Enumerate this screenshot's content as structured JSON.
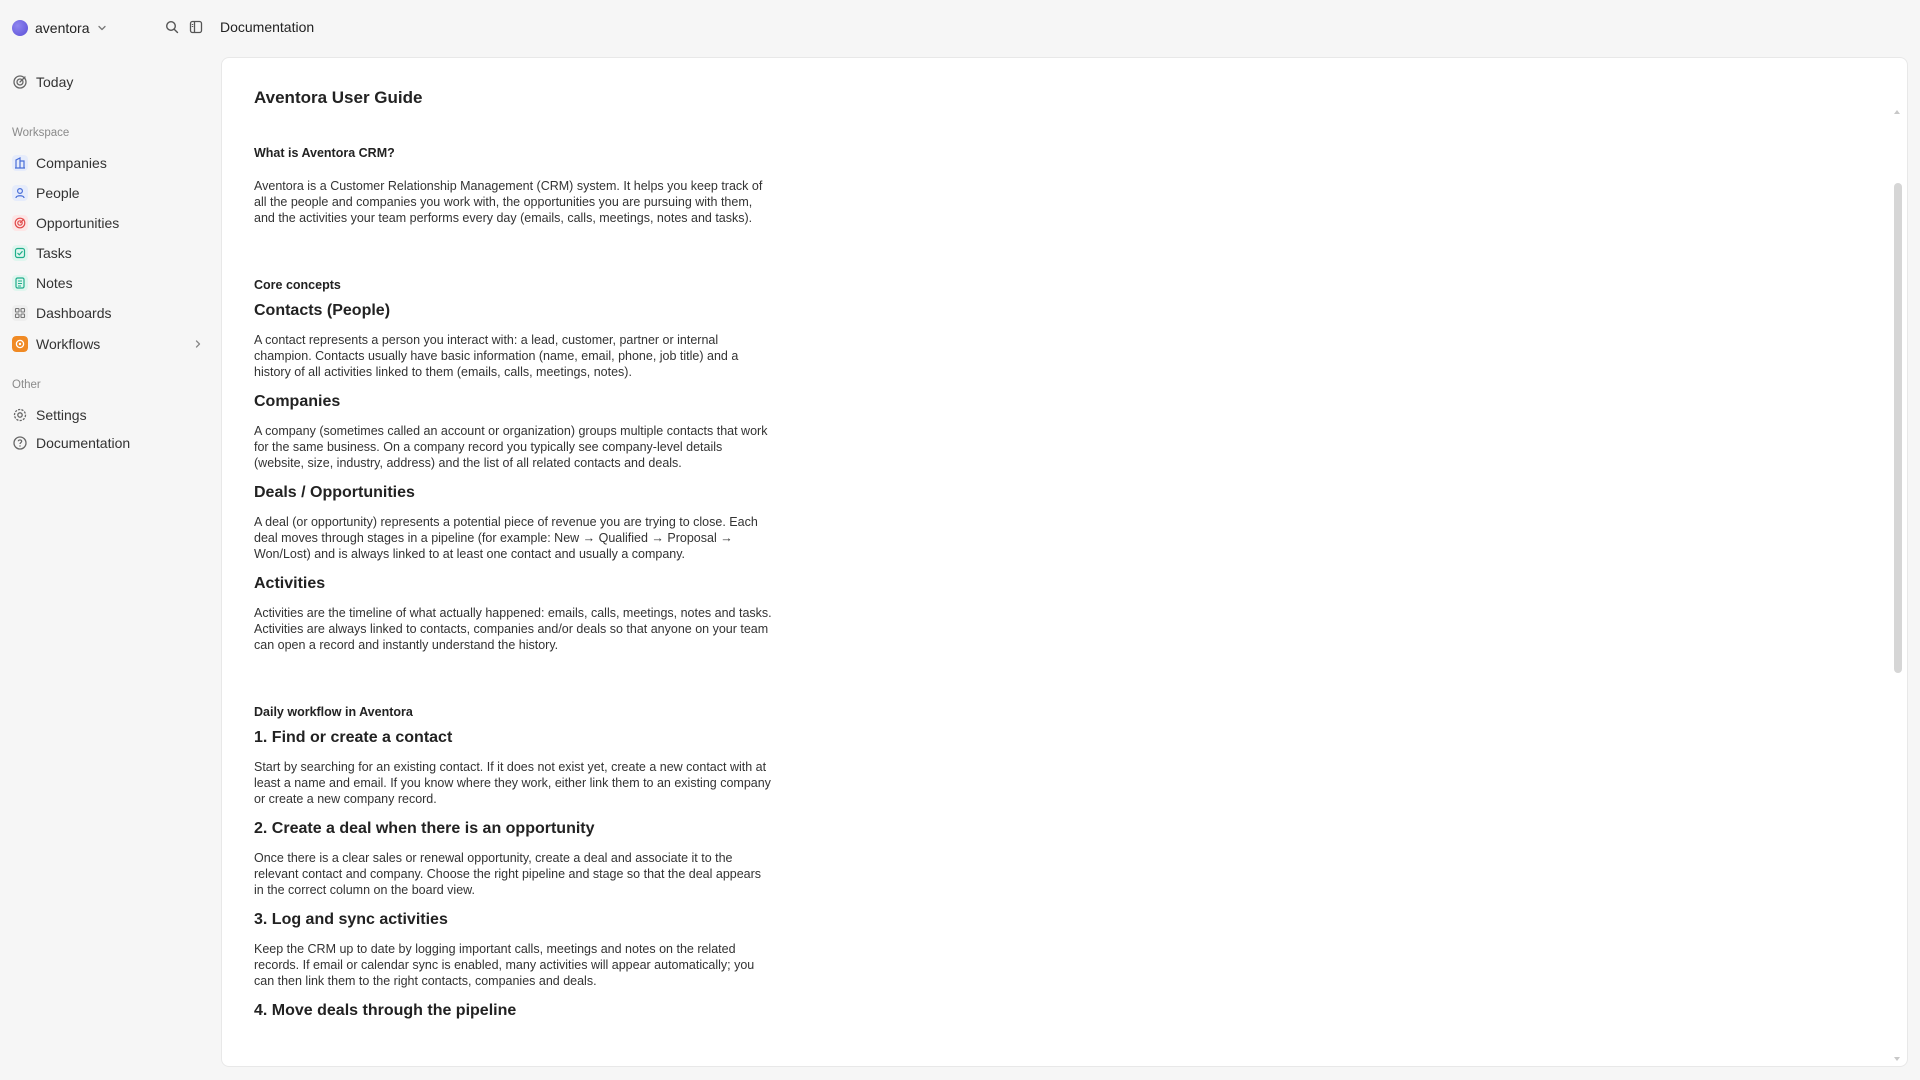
{
  "topbar": {
    "workspace_name": "aventora",
    "breadcrumb": "Documentation"
  },
  "sidebar": {
    "today": "Today",
    "workspace_label": "Workspace",
    "items": [
      {
        "label": "Companies",
        "icon": "building-icon",
        "color": "#4a6fd8"
      },
      {
        "label": "People",
        "icon": "person-icon",
        "color": "#4a6fd8"
      },
      {
        "label": "Opportunities",
        "icon": "target-icon",
        "color": "#e04a4a"
      },
      {
        "label": "Tasks",
        "icon": "checkbox-icon",
        "color": "#1fae8a"
      },
      {
        "label": "Notes",
        "icon": "note-icon",
        "color": "#1fae8a"
      },
      {
        "label": "Dashboards",
        "icon": "grid-icon",
        "color": "#888888"
      },
      {
        "label": "Workflows",
        "icon": "workflow-icon",
        "color": "#f08a24"
      }
    ],
    "other_label": "Other",
    "settings": "Settings",
    "documentation": "Documentation"
  },
  "doc": {
    "title": "Aventora User Guide",
    "what_heading": "What is Aventora CRM?",
    "what_text": "Aventora is a Customer Relationship Management (CRM) system. It helps you keep track of all the people and companies you work with, the opportunities you are pursuing with them, and the activities your team performs every day (emails, calls, meetings, notes and tasks).",
    "core_heading": "Core concepts",
    "contacts_heading": "Contacts (People)",
    "contacts_text": "A contact represents a person you interact with: a lead, customer, partner or internal champion. Contacts usually have basic information (name, email, phone, job title) and a history of all activities linked to them (emails, calls, meetings, notes).",
    "companies_heading": "Companies",
    "companies_text": "A company (sometimes called an account or organization) groups multiple contacts that work for the same business. On a company record you typically see company-level details (website, size, industry, address) and the list of all related contacts and deals.",
    "deals_heading": "Deals / Opportunities",
    "deals_text": "A deal (or opportunity) represents a potential piece of revenue you are trying to close. Each deal moves through stages in a pipeline (for example: New → Qualified → Proposal → Won/Lost) and is always linked to at least one contact and usually a company.",
    "activities_heading": "Activities",
    "activities_text": "Activities are the timeline of what actually happened: emails, calls, meetings, notes and tasks. Activities are always linked to contacts, companies and/or deals so that anyone on your team can open a record and instantly understand the history.",
    "daily_heading": "Daily workflow in Aventora",
    "step1_heading": "1. Find or create a contact",
    "step1_text": "Start by searching for an existing contact. If it does not exist yet, create a new contact with at least a name and email. If you know where they work, either link them to an existing company or create a new company record.",
    "step2_heading": "2. Create a deal when there is an opportunity",
    "step2_text": "Once there is a clear sales or renewal opportunity, create a deal and associate it to the relevant contact and company. Choose the right pipeline and stage so that the deal appears in the correct column on the board view.",
    "step3_heading": "3. Log and sync activities",
    "step3_text": "Keep the CRM up to date by logging important calls, meetings and notes on the related records. If email or calendar sync is enabled, many activities will appear automatically; you can then link them to the right contacts, companies and deals.",
    "step4_heading": "4. Move deals through the pipeline"
  }
}
